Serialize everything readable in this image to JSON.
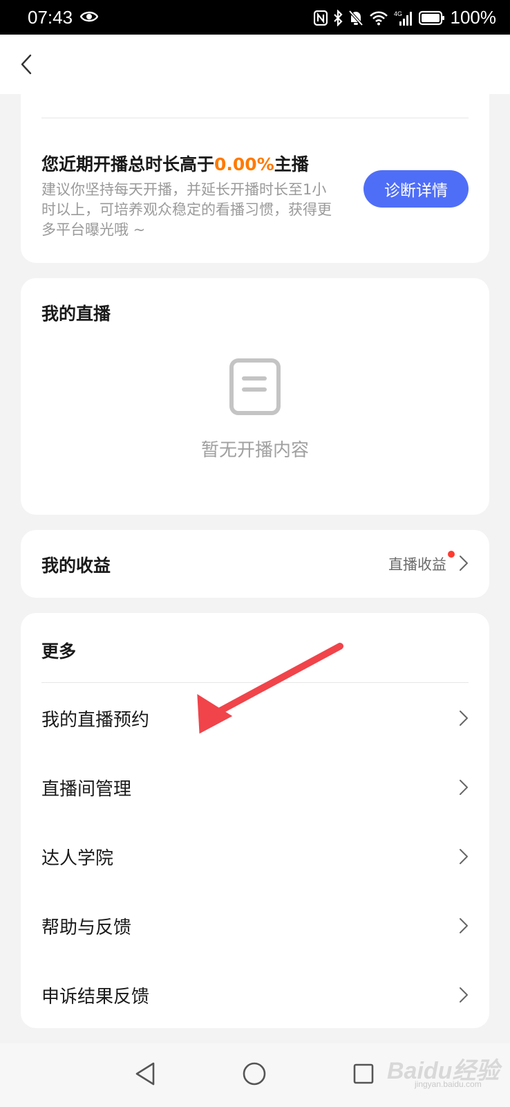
{
  "status_bar": {
    "time": "07:43",
    "battery": "100%",
    "icons": [
      "eye-icon",
      "nfc-icon",
      "bluetooth-icon",
      "mute-bell-icon",
      "wifi-icon",
      "signal-4g-icon",
      "battery-icon"
    ]
  },
  "header": {
    "back_icon": "chevron-left-icon"
  },
  "diagnosis": {
    "title_prefix": "您近期开播总时长高于",
    "title_percent": "0.00%",
    "title_suffix": "主播",
    "description": "建议你坚持每天开播，并延长开播时长至1小时以上，可培养观众稳定的看播习惯，获得更多平台曝光哦 ~",
    "button_label": "诊断详情",
    "accent_color": "#ff7a00",
    "button_color": "#4f6ef7"
  },
  "my_live": {
    "title": "我的直播",
    "empty_icon": "document-icon",
    "empty_text": "暂无开播内容"
  },
  "income": {
    "title": "我的收益",
    "link_label": "直播收益",
    "badge_color": "#ff3b30"
  },
  "more": {
    "title": "更多",
    "items": [
      {
        "label": "我的直播预约"
      },
      {
        "label": "直播间管理"
      },
      {
        "label": "达人学院"
      },
      {
        "label": "帮助与反馈"
      },
      {
        "label": "申诉结果反馈"
      }
    ]
  },
  "nav_bar": {
    "icons": [
      "back-triangle-icon",
      "home-circle-icon",
      "recent-square-icon"
    ]
  },
  "watermark": {
    "text": "Baidu经验",
    "sub": "jingyan.baidu.com"
  },
  "annotation": {
    "color": "#f0444a"
  }
}
